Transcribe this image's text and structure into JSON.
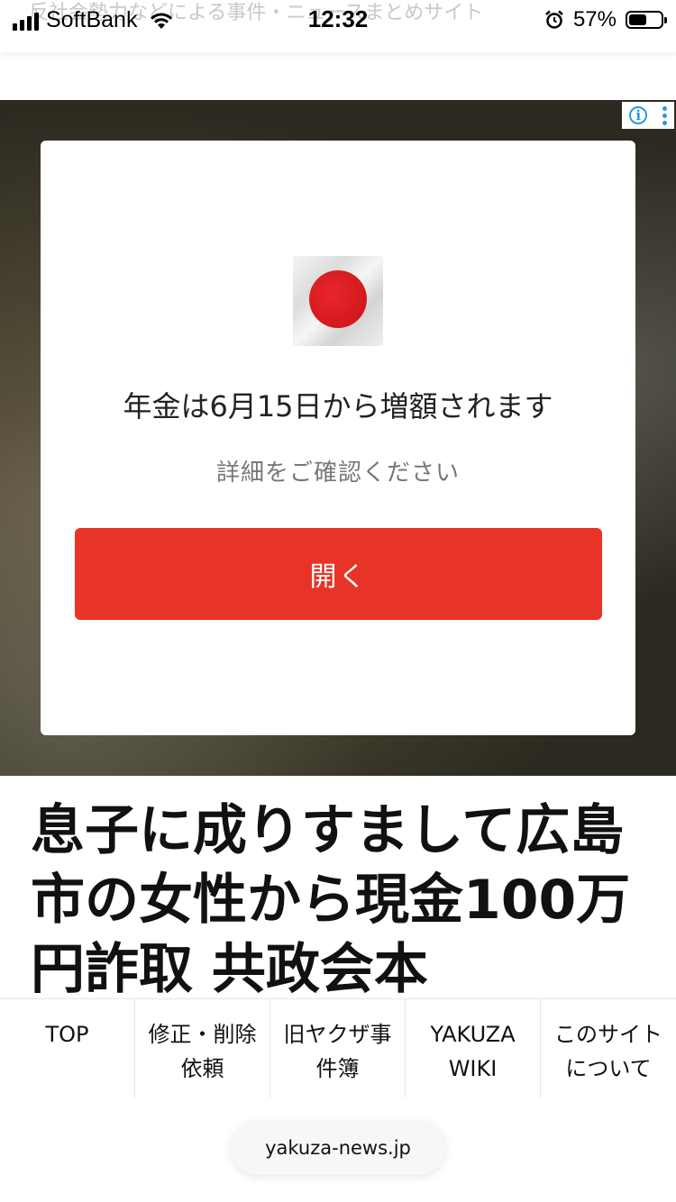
{
  "status_bar": {
    "overlay_text": "反社会勢力などによる事件・ニュースまとめサイト",
    "carrier": "SoftBank",
    "time": "12:32",
    "battery_percent": "57%",
    "battery_level": 0.57,
    "icons": [
      "signal-icon",
      "wifi-icon",
      "alarm-icon",
      "battery-icon"
    ]
  },
  "ad": {
    "headline": "年金は6月15日から増額されます",
    "subtext": "詳細をご確認ください",
    "button_label": "開く",
    "button_color": "#e83427",
    "choices_icons": [
      "info-icon",
      "kebab-icon"
    ]
  },
  "article": {
    "title": "息子に成りすまして広島市の女性から現金100万円詐取 共政会本"
  },
  "bottom_nav": {
    "items": [
      {
        "label": "TOP"
      },
      {
        "label": "修正・削除\n依頼"
      },
      {
        "label": "旧ヤクザ事\n件簿"
      },
      {
        "label": "YAKUZA\nWIKI"
      },
      {
        "label": "このサイト\nについて"
      }
    ]
  },
  "browser": {
    "url": "yakuza-news.jp"
  }
}
